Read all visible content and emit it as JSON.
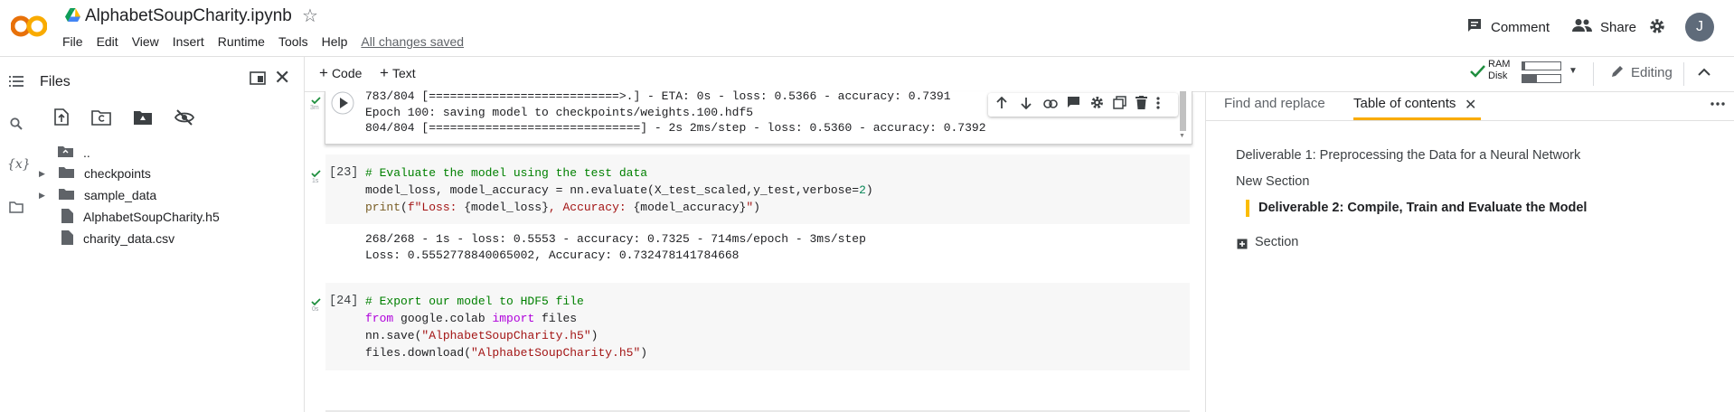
{
  "header": {
    "title": "AlphabetSoupCharity.ipynb",
    "menu": [
      "File",
      "Edit",
      "View",
      "Insert",
      "Runtime",
      "Tools",
      "Help"
    ],
    "saved_status": "All changes saved",
    "comment_label": "Comment",
    "share_label": "Share",
    "avatar_letter": "J"
  },
  "toolbar": {
    "code_label": "Code",
    "text_label": "Text",
    "ram_label": "RAM",
    "disk_label": "Disk",
    "editing_label": "Editing"
  },
  "files": {
    "title": "Files",
    "parent": "..",
    "items": [
      {
        "name": "checkpoints",
        "type": "folder"
      },
      {
        "name": "sample_data",
        "type": "folder"
      },
      {
        "name": "AlphabetSoupCharity.h5",
        "type": "file"
      },
      {
        "name": "charity_data.csv",
        "type": "file"
      }
    ]
  },
  "cells": {
    "prev_output": {
      "exec_time": "3m",
      "lines": [
        "783/804 [===========================>.] - ETA: 0s - loss: 0.5366 - accuracy: 0.7391",
        "Epoch 100: saving model to checkpoints/weights.100.hdf5",
        "804/804 [==============================] - 2s 2ms/step - loss: 0.5360 - accuracy: 0.7392"
      ]
    },
    "cell23": {
      "exec_count": "[23]",
      "exec_time": "1s",
      "comment": "# Evaluate the model using the test data",
      "line2_a": "model_loss, model_accuracy = nn.evaluate(X_test_scaled,y_test,verbose=",
      "line2_num": "2",
      "line2_b": ")",
      "line3_print": "print",
      "line3_open": "(",
      "line3_f": "f\"Loss: ",
      "line3_v1": "{model_loss}",
      "line3_mid": ", Accuracy: ",
      "line3_v2": "{model_accuracy}",
      "line3_end": "\"",
      "line3_close": ")",
      "output": [
        "268/268 - 1s - loss: 0.5553 - accuracy: 0.7325 - 714ms/epoch - 3ms/step",
        "Loss: 0.5552778840065002, Accuracy: 0.732478141784668"
      ]
    },
    "cell24": {
      "exec_count": "[24]",
      "exec_time": "0s",
      "comment": "# Export our model to HDF5 file",
      "l2_from": "from",
      "l2_mod": " google.colab ",
      "l2_import": "import",
      "l2_files": " files",
      "l3_a": "nn.save(",
      "l3_str": "\"AlphabetSoupCharity.h5\"",
      "l3_b": ")",
      "l4_a": "files.download(",
      "l4_str": "\"AlphabetSoupCharity.h5\"",
      "l4_b": ")"
    }
  },
  "right_panel": {
    "tab_find": "Find and replace",
    "tab_toc": "Table of contents",
    "toc": [
      "Deliverable 1: Preprocessing the Data for a Neural Network",
      "New Section",
      "Deliverable 2: Compile, Train and Evaluate the Model",
      "Section"
    ]
  },
  "colors": {
    "accent_orange": "#f9ab00",
    "check_green": "#1e8e3e",
    "toc_highlight": "#fbbc04"
  }
}
